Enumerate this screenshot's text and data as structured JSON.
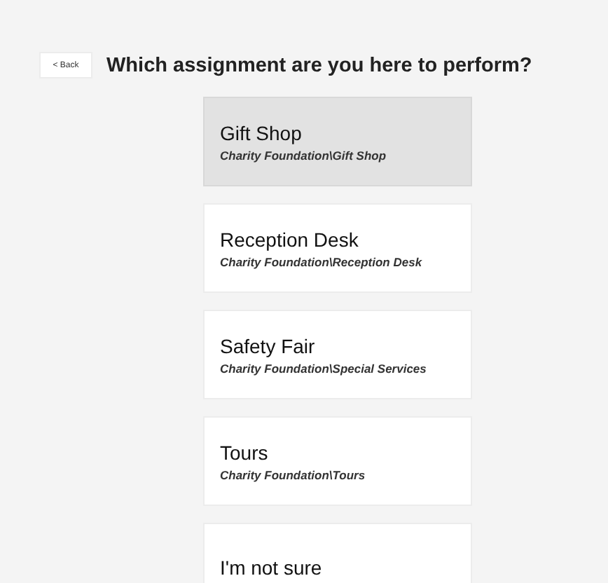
{
  "back_button": {
    "label": "< Back"
  },
  "title": "Which assignment are you here to perform?",
  "assignments": [
    {
      "name": "Gift Shop",
      "path": "Charity Foundation\\Gift Shop",
      "selected": true
    },
    {
      "name": "Reception Desk",
      "path": "Charity Foundation\\Reception Desk",
      "selected": false
    },
    {
      "name": "Safety Fair",
      "path": "Charity Foundation\\Special Services",
      "selected": false
    },
    {
      "name": "Tours",
      "path": "Charity Foundation\\Tours",
      "selected": false
    },
    {
      "name": "I'm not sure",
      "selected": false
    }
  ]
}
